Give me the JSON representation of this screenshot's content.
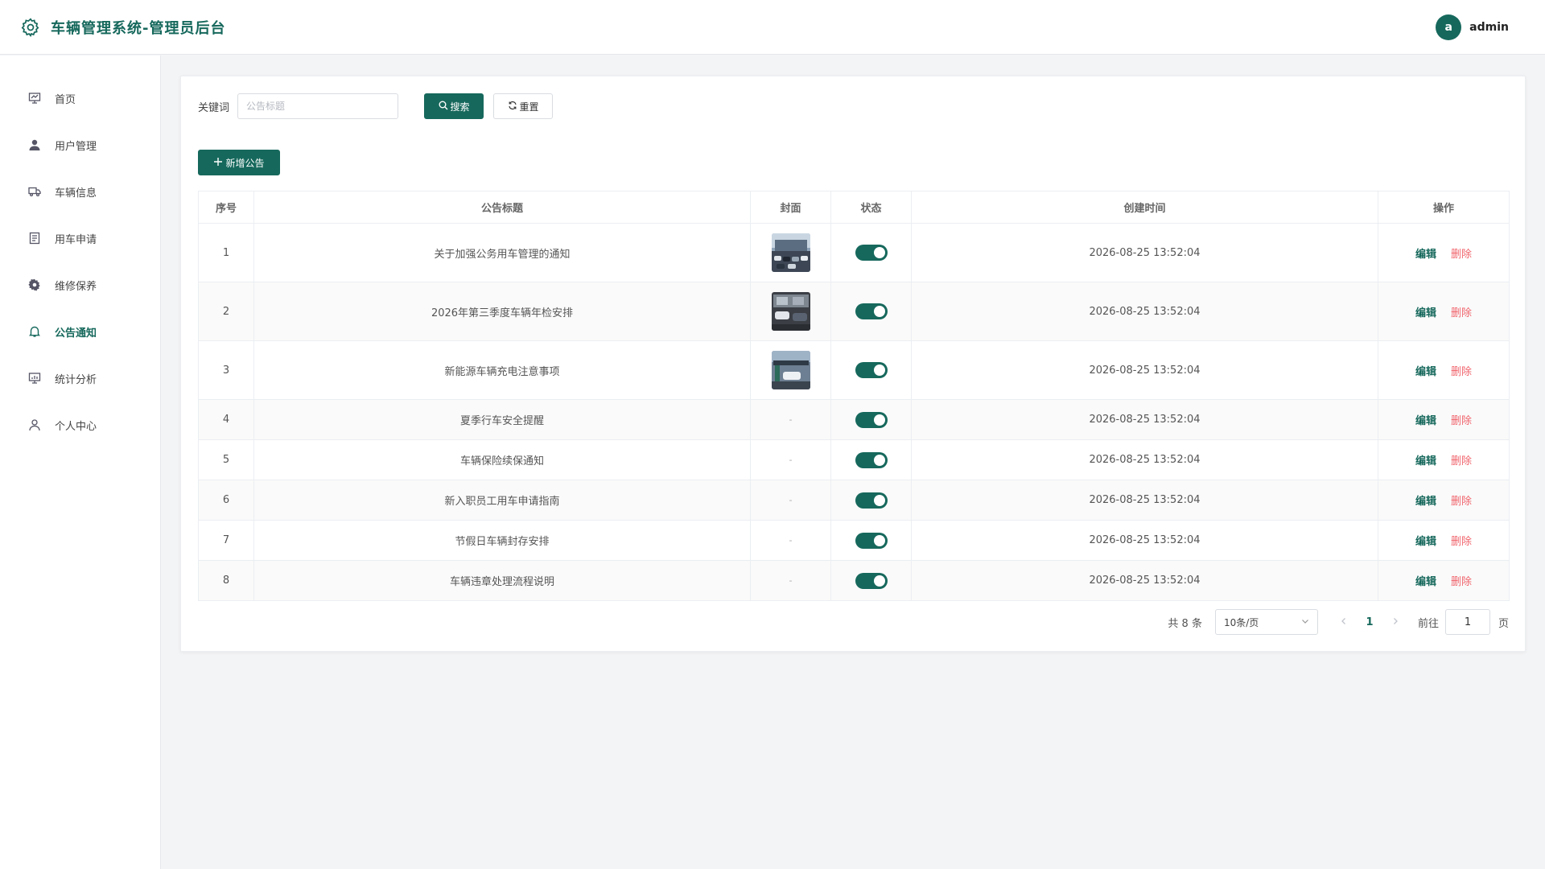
{
  "header": {
    "title": "车辆管理系统-管理员后台",
    "avatar_letter": "a",
    "username": "admin"
  },
  "sidebar": {
    "items": [
      {
        "label": "首页",
        "icon": "presentation-icon"
      },
      {
        "label": "用户管理",
        "icon": "user-icon"
      },
      {
        "label": "车辆信息",
        "icon": "truck-icon"
      },
      {
        "label": "用车申请",
        "icon": "document-icon"
      },
      {
        "label": "维修保养",
        "icon": "gear-icon"
      },
      {
        "label": "公告通知",
        "icon": "bell-icon",
        "active": true
      },
      {
        "label": "统计分析",
        "icon": "chart-icon"
      },
      {
        "label": "个人中心",
        "icon": "person-icon"
      }
    ]
  },
  "search": {
    "label": "关键词",
    "placeholder": "公告标题",
    "search_label": "搜索",
    "reset_label": "重置"
  },
  "toolbar": {
    "add_label": "新增公告"
  },
  "table": {
    "headers": [
      "序号",
      "公告标题",
      "封面",
      "状态",
      "创建时间",
      "操作"
    ],
    "edit_label": "编辑",
    "delete_label": "删除",
    "empty_cover": "-",
    "rows": [
      {
        "index": "1",
        "title": "关于加强公务用车管理的通知",
        "cover": "parking-lot",
        "status": true,
        "created": "2026-08-25 13:52:04"
      },
      {
        "index": "2",
        "title": "2026年第三季度车辆年检安排",
        "cover": "garage",
        "status": true,
        "created": "2026-08-25 13:52:04"
      },
      {
        "index": "3",
        "title": "新能源车辆充电注意事项",
        "cover": "charging-station",
        "status": true,
        "created": "2026-08-25 13:52:04"
      },
      {
        "index": "4",
        "title": "夏季行车安全提醒",
        "cover": null,
        "status": true,
        "created": "2026-08-25 13:52:04"
      },
      {
        "index": "5",
        "title": "车辆保险续保通知",
        "cover": null,
        "status": true,
        "created": "2026-08-25 13:52:04"
      },
      {
        "index": "6",
        "title": "新入职员工用车申请指南",
        "cover": null,
        "status": true,
        "created": "2026-08-25 13:52:04"
      },
      {
        "index": "7",
        "title": "节假日车辆封存安排",
        "cover": null,
        "status": true,
        "created": "2026-08-25 13:52:04"
      },
      {
        "index": "8",
        "title": "车辆违章处理流程说明",
        "cover": null,
        "status": true,
        "created": "2026-08-25 13:52:04"
      }
    ]
  },
  "pagination": {
    "total_text": "共 8 条",
    "page_size": "10条/页",
    "current_page": "1",
    "goto_label": "前往",
    "goto_value": "1",
    "page_suffix": "页"
  },
  "colors": {
    "primary": "#16685c",
    "danger": "#f0646c"
  }
}
